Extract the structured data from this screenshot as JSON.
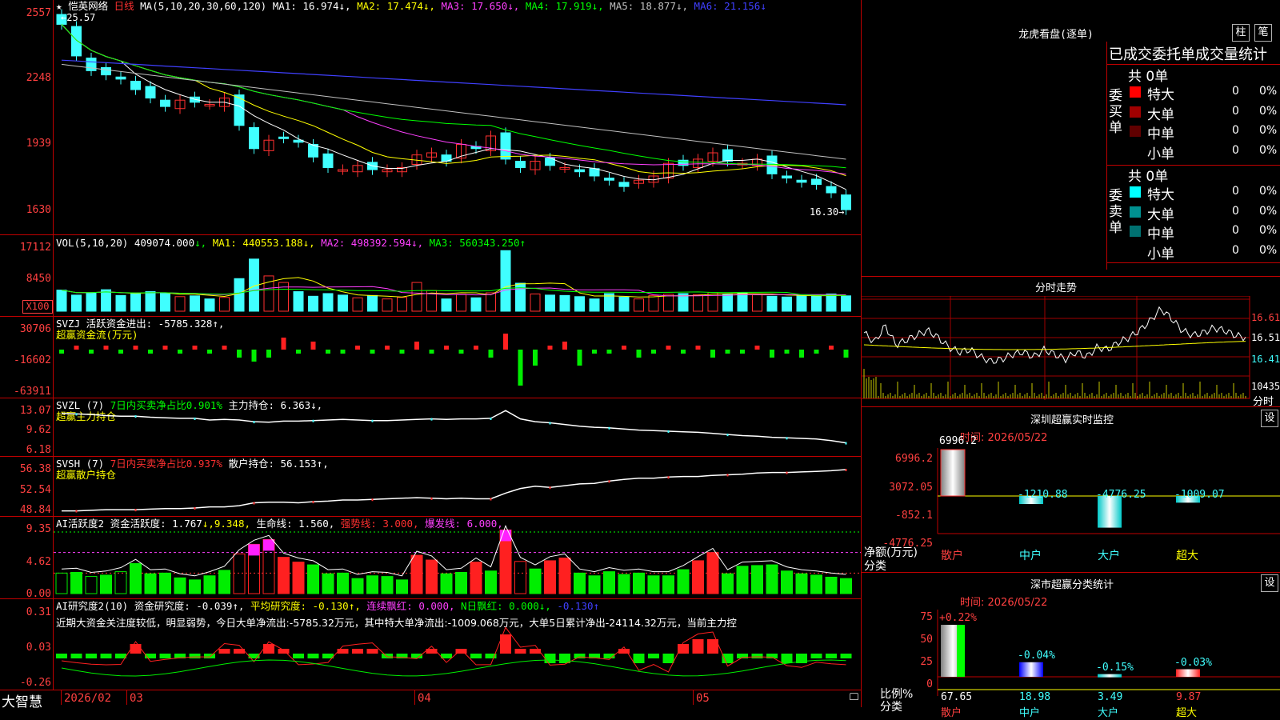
{
  "main": {
    "stock_name": "恺英网络",
    "period": "日线",
    "ma_header": "MA(5,10,20,30,60,120)",
    "high_marker": "25.57",
    "low_marker": "16.30",
    "ma_values": [
      {
        "label": "MA1: 16.974↓,",
        "color": "#ffffff"
      },
      {
        "label": "MA2: 17.474↓,",
        "color": "#ffff00"
      },
      {
        "label": "MA3: 17.650↓,",
        "color": "#ff40ff"
      },
      {
        "label": "MA4: 17.919↓,",
        "color": "#00ff00"
      },
      {
        "label": "MA5: 18.877↓,",
        "color": "#c0c0c0"
      },
      {
        "label": "MA6: 21.156↓",
        "color": "#4040ff"
      }
    ],
    "y_ticks": [
      "2557",
      "2248",
      "1939",
      "1630"
    ],
    "candles_close": [
      25.1,
      23.6,
      22.9,
      22.7,
      22.5,
      22.0,
      21.6,
      21.2,
      21.5,
      21.4,
      21.3,
      21.6,
      20.3,
      19.2,
      19.6,
      19.7,
      19.5,
      18.8,
      18.3,
      18.2,
      18.4,
      18.2,
      18.2,
      18.3,
      18.9,
      19.0,
      18.6,
      19.4,
      19.2,
      19.8,
      18.7,
      18.3,
      18.6,
      18.4,
      18.3,
      18.1,
      17.9,
      17.7,
      17.4,
      17.7,
      17.9,
      18.5,
      18.4,
      18.7,
      19.0,
      18.6,
      18.5,
      18.7,
      18.0,
      17.8,
      17.6,
      17.5,
      17.1,
      16.3
    ]
  },
  "vol": {
    "header": "VOL(5,10,20)",
    "cur": "409074.000",
    "arrow": "↓,",
    "ma1": "MA1: 440553.188↓,",
    "ma2": "MA2: 498392.594↓,",
    "ma3": "MA3: 560343.250↑",
    "y_ticks": [
      "17112",
      "8450"
    ],
    "unit": "X100",
    "values": [
      5.5,
      4.2,
      4.8,
      5.6,
      4.1,
      4.5,
      5.1,
      4.7,
      3.8,
      4.0,
      3.2,
      3.6,
      8.5,
      13.6,
      9.2,
      7.5,
      5.1,
      3.9,
      4.6,
      4.2,
      3.5,
      4.1,
      3.2,
      3.6,
      7.5,
      5.4,
      3.2,
      4.4,
      3.5,
      4.8,
      15.8,
      7.3,
      4.5,
      4.2,
      4.1,
      3.8,
      3.2,
      4.6,
      3.7,
      3.2,
      4.1,
      4.4,
      4.6,
      4.3,
      4.9,
      4.5,
      4.8,
      4.3,
      3.9,
      3.7,
      4.0,
      4.2,
      4.5,
      4.0
    ]
  },
  "svzj": {
    "header": "SVZJ  活跃资金进出: -5785.328↑,",
    "sub": "超赢资金流(万元)",
    "y_ticks": [
      "30706",
      "-16602",
      "-63911"
    ],
    "values": [
      -1,
      1,
      -1,
      1,
      -1,
      1,
      -1,
      1,
      -1,
      1,
      -1,
      1,
      -2,
      -3,
      -2,
      3,
      -1,
      2,
      -1,
      -1,
      1,
      -1,
      1,
      -1,
      2,
      -1,
      1,
      -1,
      1,
      -2,
      4,
      -9,
      -4,
      1,
      2,
      -4,
      -1,
      -1,
      1,
      -2,
      -1,
      1,
      -1,
      1,
      -2,
      -1,
      -1,
      1,
      -2,
      -1,
      -2,
      -1,
      1,
      -2
    ]
  },
  "svzl": {
    "header_a": "SVZL (7)",
    "header_b": "7日内买卖净占比0.901%",
    "header_c": "主力持仓: 6.363↓,",
    "sub": "超赢主力持仓",
    "y_ticks": [
      "13.07",
      "9.62",
      "6.18"
    ],
    "values": [
      12.4,
      12.3,
      12.2,
      12.0,
      11.9,
      11.9,
      11.7,
      11.6,
      11.5,
      11.5,
      11.2,
      11.3,
      11.2,
      10.9,
      10.8,
      11.0,
      11.0,
      11.1,
      11.2,
      11.3,
      11.2,
      11.1,
      11.1,
      11.2,
      11.3,
      11.4,
      11.3,
      11.4,
      11.4,
      11.5,
      12.9,
      11.4,
      10.9,
      10.7,
      10.4,
      10.1,
      9.9,
      9.8,
      9.6,
      9.4,
      9.3,
      9.2,
      9.1,
      9.0,
      8.8,
      8.6,
      8.4,
      8.3,
      8.1,
      8.0,
      7.9,
      7.8,
      7.5,
      7.1
    ]
  },
  "svsh": {
    "header_a": "SVSH (7)",
    "header_b": "7日内买卖净占比0.937%",
    "header_c": "散户持仓: 56.153↑,",
    "sub": "超赢散户持仓",
    "y_ticks": [
      "56.38",
      "52.54",
      "48.84"
    ],
    "values": [
      48.9,
      48.9,
      49.0,
      49.1,
      49.1,
      49.1,
      49.2,
      49.3,
      49.3,
      49.4,
      49.6,
      49.6,
      49.8,
      50.3,
      50.4,
      50.4,
      50.3,
      50.5,
      50.6,
      50.8,
      50.8,
      50.9,
      51.0,
      51.1,
      51.2,
      51.1,
      51.0,
      51.1,
      51.0,
      51.0,
      52.0,
      52.8,
      53.2,
      53.0,
      53.3,
      53.6,
      53.7,
      54.1,
      54.4,
      54.6,
      54.6,
      54.8,
      54.9,
      54.9,
      55.1,
      55.2,
      55.3,
      55.5,
      55.6,
      55.6,
      55.7,
      55.8,
      55.9,
      56.1
    ]
  },
  "ai1": {
    "header": "AI活跃度2 资金活跃度: 1.767",
    "v1": "↓,9.348,",
    "v2": "生命线: 1.560,",
    "v3": "强势线: 3.000,",
    "v4": "爆发线: 6.000,",
    "y_ticks": [
      "9.35",
      "4.62",
      "0.00"
    ],
    "values": [
      3.0,
      3.1,
      2.5,
      2.7,
      3.2,
      4.4,
      2.9,
      3.0,
      2.3,
      2.0,
      2.6,
      3.4,
      5.8,
      7.2,
      7.9,
      5.3,
      4.6,
      4.2,
      2.9,
      3.0,
      2.2,
      2.6,
      2.5,
      2.0,
      5.6,
      4.9,
      2.9,
      3.1,
      4.6,
      3.3,
      9.3,
      4.7,
      3.6,
      4.8,
      5.2,
      3.0,
      2.6,
      3.2,
      2.8,
      3.0,
      2.6,
      2.6,
      3.5,
      4.8,
      6.0,
      2.9,
      4.0,
      4.1,
      4.2,
      3.3,
      2.9,
      2.7,
      2.4,
      2.2
    ]
  },
  "ai2": {
    "header": "AI研究度2(10)  资金研究度: -0.039↑,",
    "v1": "平均研究度: -0.130↑,",
    "v2": "连续飘红: 0.000,",
    "v3": "N日飘红: 0.000↓,",
    "v4": "-0.130↑",
    "comment": "近期大资金关注度较低，明显弱势，今日大单净流出:-5785.32万元，其中特大单净流出:-1009.068万元，大单5日累计净出-24114.32万元，当前主力控",
    "y_ticks": [
      "0.31",
      "0.03",
      "-0.26"
    ],
    "values": [
      -1,
      -1,
      -1,
      -1,
      -1,
      2,
      -1,
      -1,
      -1,
      -1,
      -1,
      1,
      1,
      -1,
      2,
      1,
      -1,
      -1,
      -1,
      1,
      1,
      1,
      -1,
      -1,
      -1,
      1,
      -1,
      1,
      -1,
      -1,
      4,
      1,
      1,
      -2,
      -2,
      -1,
      -1,
      -1,
      1,
      -2,
      -1,
      -2,
      2,
      3,
      3,
      -2,
      -1,
      -1,
      -1,
      -2,
      -2,
      -1,
      -1,
      -1
    ]
  },
  "bottom": {
    "brand": "大智慧",
    "dates": [
      {
        "label": "2026/02",
        "x": 80
      },
      {
        "label": "03",
        "x": 162
      },
      {
        "label": "04",
        "x": 522
      },
      {
        "label": "05",
        "x": 870
      }
    ]
  },
  "lhb": {
    "title": "龙虎看盘(逐单)",
    "btn1": "柱",
    "btn2": "笔",
    "subtitle": "已成交委托单成交量统计",
    "buy_total": "共 0单",
    "buy_label": "委买单",
    "buy_rows": [
      {
        "name": "特大",
        "val": "0",
        "pct": "0%",
        "color": "#ff0000"
      },
      {
        "name": "大单",
        "val": "0",
        "pct": "0%",
        "color": "#a00000"
      },
      {
        "name": "中单",
        "val": "0",
        "pct": "0%",
        "color": "#600000"
      },
      {
        "name": "小单",
        "val": "0",
        "pct": "0%",
        "color": ""
      }
    ],
    "sell_total": "共 0单",
    "sell_label": "委卖单",
    "sell_rows": [
      {
        "name": "特大",
        "val": "0",
        "pct": "0%",
        "color": "#00ffff"
      },
      {
        "name": "大单",
        "val": "0",
        "pct": "0%",
        "color": "#009090"
      },
      {
        "name": "中单",
        "val": "0",
        "pct": "0%",
        "color": "#007070"
      },
      {
        "name": "小单",
        "val": "0",
        "pct": "0%",
        "color": ""
      }
    ]
  },
  "fenshi": {
    "title": "分时走势",
    "y_ticks": [
      "16.61",
      "16.51",
      "16.41"
    ],
    "vol_tick": "10435",
    "unit": "分时",
    "price": [
      16.52,
      16.48,
      16.55,
      16.47,
      16.49,
      16.51,
      16.53,
      16.5,
      16.46,
      16.44,
      16.45,
      16.42,
      16.4,
      16.41,
      16.43,
      16.44,
      16.42,
      16.45,
      16.43,
      16.41,
      16.44,
      16.42,
      16.46,
      16.45,
      16.48,
      16.5,
      16.53,
      16.57,
      16.62,
      16.58,
      16.53,
      16.51,
      16.52,
      16.54,
      16.53,
      16.51,
      16.5
    ]
  },
  "monitor": {
    "title": "深圳超赢实时监控",
    "btn": "设",
    "time": "时间: 2026/05/22",
    "y_ticks": [
      "6996.2",
      "3072.05",
      "-852.1",
      "-4776.25"
    ],
    "ylabel": "净额(万元)",
    "xlabel": "分类",
    "cats": [
      "散户",
      "中户",
      "大户",
      "超大"
    ],
    "bars": [
      {
        "label": "6996.2",
        "value": 6996.2,
        "style": "gray"
      },
      {
        "label": "-1210.88",
        "value": -1210.88,
        "style": "cyan"
      },
      {
        "label": "-4776.25",
        "value": -4776.25,
        "style": "cyan"
      },
      {
        "label": "-1009.07",
        "value": -1009.07,
        "style": "cyan"
      }
    ]
  },
  "classify": {
    "title": "深市超赢分类统计",
    "btn": "设",
    "time": "时间: 2026/05/22",
    "y_ticks": [
      "75",
      "50",
      "25",
      "0"
    ],
    "ylabel": "比例%",
    "xlabel": "分类",
    "cats": [
      "散户",
      "中户",
      "大户",
      "超大"
    ],
    "bars": [
      {
        "pct": "67.65",
        "chg": "+0.22%",
        "value": 67.65,
        "style": "gray"
      },
      {
        "pct": "18.98",
        "chg": "-0.04%",
        "value": 18.98,
        "style": "blue"
      },
      {
        "pct": "3.49",
        "chg": "-0.15%",
        "value": 3.49,
        "style": "cyan"
      },
      {
        "pct": "9.87",
        "chg": "-0.03%",
        "value": 9.87,
        "style": "red"
      }
    ]
  }
}
